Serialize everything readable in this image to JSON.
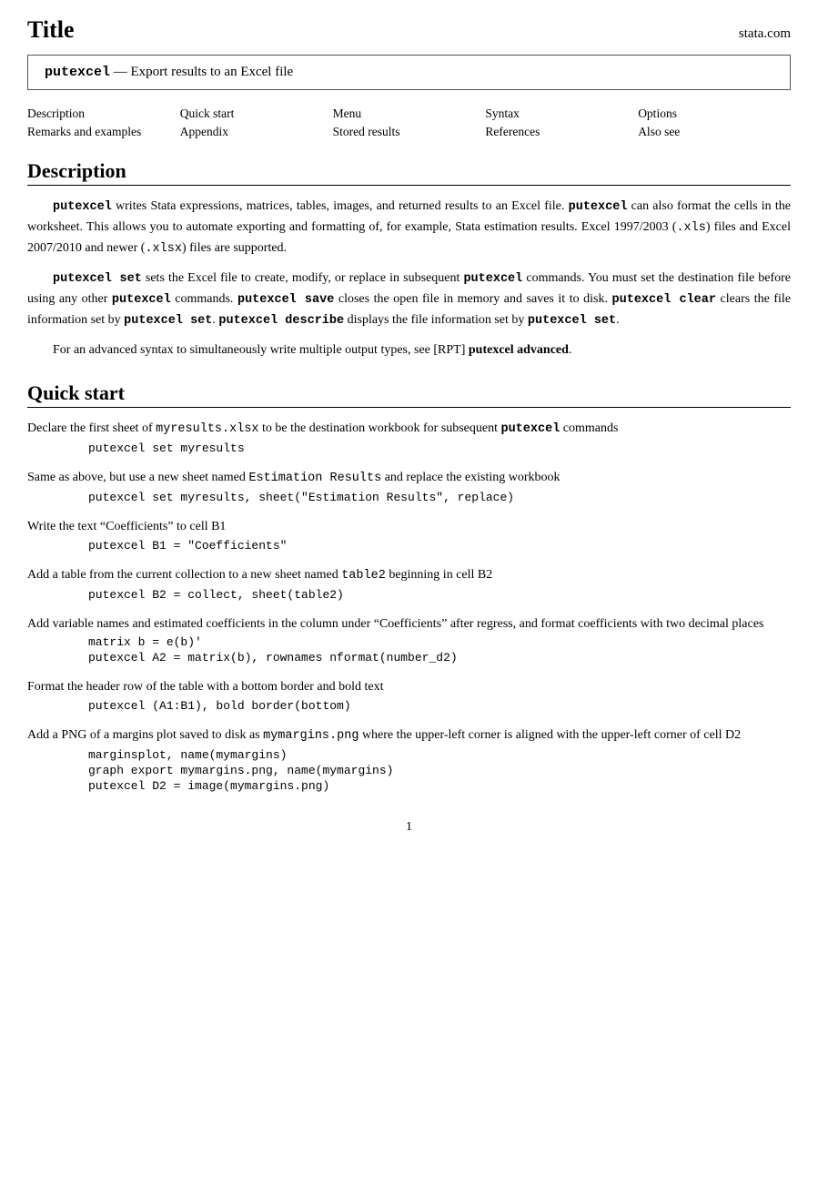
{
  "header": {
    "title": "Title",
    "brand": "stata.com"
  },
  "titlebox": {
    "command": "putexcel",
    "dash": "—",
    "description": "Export results to an Excel file"
  },
  "nav": {
    "col1": [
      "Description",
      "Remarks and examples"
    ],
    "col2": [
      "Quick start",
      "Appendix"
    ],
    "col3": [
      "Menu",
      "Stored results"
    ],
    "col4": [
      "Syntax",
      "References"
    ],
    "col5": [
      "Options",
      "Also see"
    ]
  },
  "description": {
    "heading": "Description",
    "para1": "putexcel writes Stata expressions, matrices, tables, images, and returned results to an Excel file. putexcel can also format the cells in the worksheet. This allows you to automate exporting and formatting of, for example, Stata estimation results. Excel 1997/2003 (.xls) files and Excel 2007/2010 and newer (.xlsx) files are supported.",
    "para2": "putexcel set sets the Excel file to create, modify, or replace in subsequent putexcel commands. You must set the destination file before using any other putexcel commands. putexcel save closes the open file in memory and saves it to disk. putexcel clear clears the file information set by putexcel set. putexcel describe displays the file information set by putexcel set.",
    "para3": "For an advanced syntax to simultaneously write multiple output types, see [RPT] putexcel advanced."
  },
  "quickstart": {
    "heading": "Quick start",
    "items": [
      {
        "text": "Declare the first sheet of myresults.xlsx to be the destination workbook for subsequent putexcel commands",
        "codes": [
          "putexcel set myresults"
        ]
      },
      {
        "text": "Same as above, but use a new sheet named Estimation Results and replace the existing workbook",
        "codes": [
          "putexcel set myresults, sheet(\"Estimation Results\", replace)"
        ]
      },
      {
        "text": "Write the text “Coefficients” to cell B1",
        "codes": [
          "putexcel B1 = \"Coefficients\""
        ]
      },
      {
        "text": "Add a table from the current collection to a new sheet named table2 beginning in cell B2",
        "codes": [
          "putexcel B2 = collect, sheet(table2)"
        ]
      },
      {
        "text": "Add variable names and estimated coefficients in the column under “Coefficients” after regress, and format coefficients with two decimal places",
        "codes": [
          "matrix b = e(b)'",
          "putexcel A2 = matrix(b), rownames nformat(number_d2)"
        ]
      },
      {
        "text": "Format the header row of the table with a bottom border and bold text",
        "codes": [
          "putexcel (A1:B1), bold border(bottom)"
        ]
      },
      {
        "text": "Add a PNG of a margins plot saved to disk as mymargins.png where the upper-left corner is aligned with the upper-left corner of cell D2",
        "codes": [
          "marginsplot, name(mymargins)",
          "graph export mymargins.png, name(mymargins)",
          "putexcel D2 = image(mymargins.png)"
        ]
      }
    ]
  },
  "footer": {
    "page_number": "1"
  }
}
